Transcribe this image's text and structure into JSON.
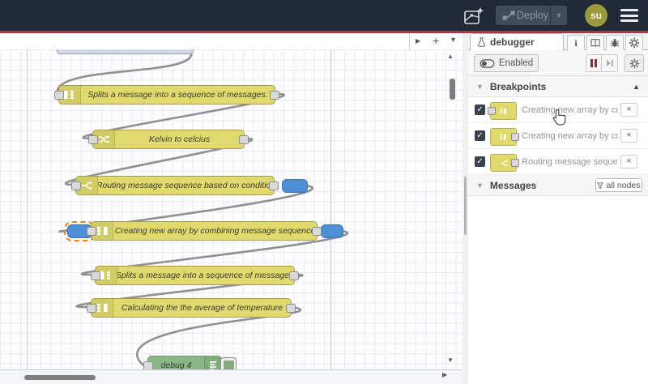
{
  "header": {
    "deploy_label": "Deploy",
    "avatar_text": "su",
    "colors": {
      "header_bg": "#212b38",
      "accent_red": "#a63a44",
      "deploy_bg": "#414b5a",
      "avatar_olive": "#9a9a3d"
    }
  },
  "workspace": {
    "tab_buttons": {
      "scroll_right": "▶",
      "add_flow": "+",
      "flow_list": "▾"
    }
  },
  "canvas": {
    "nodes": [
      {
        "id": "split-1",
        "type": "split",
        "label": "Splits a message into a sequence of messages."
      },
      {
        "id": "change-1",
        "type": "change",
        "label": "Kelvin to celcius"
      },
      {
        "id": "switch-1",
        "type": "switch",
        "label": "Routing message sequence based on condition",
        "breakpoints": [
          "output"
        ]
      },
      {
        "id": "join-1",
        "type": "join",
        "label": "Creating new array by combining message sequence",
        "breakpoints": [
          "input",
          "output"
        ],
        "selected_breakpoint": "input"
      },
      {
        "id": "split-2",
        "type": "split",
        "label": "Splits a message into a sequence of messages."
      },
      {
        "id": "join-2",
        "type": "join",
        "label": "Calculating the the average of temperature"
      },
      {
        "id": "debug-1",
        "type": "debug",
        "label": "debug 4",
        "toggle": "enabled"
      }
    ],
    "colors": {
      "node_yellow": "#e0d96b",
      "debug_green": "#8ab885",
      "breakpoint_blue": "#4e8ed7",
      "selection_orange": "#ff7f0e",
      "wire": "#909090"
    }
  },
  "sidebar": {
    "active_tab_label": "debugger",
    "tab_icons": [
      "info",
      "book",
      "bug",
      "gear"
    ],
    "toolbar": {
      "enabled_label": "Enabled",
      "buttons": [
        "pause",
        "step",
        "settings"
      ]
    },
    "breakpoints": {
      "title": "Breakpoints",
      "items": [
        {
          "label": "Creating new array by combining message sequence",
          "node_type": "join",
          "port_side": "input",
          "checked": true
        },
        {
          "label": "Creating new array by combining message sequence",
          "node_type": "join",
          "port_side": "output",
          "checked": true
        },
        {
          "label": "Routing message sequence based on condition",
          "node_type": "switch",
          "port_side": "output",
          "checked": true
        }
      ],
      "check_glyph": "✓",
      "remove_glyph": "×"
    },
    "messages": {
      "title": "Messages",
      "filter_label": "all nodes"
    }
  }
}
